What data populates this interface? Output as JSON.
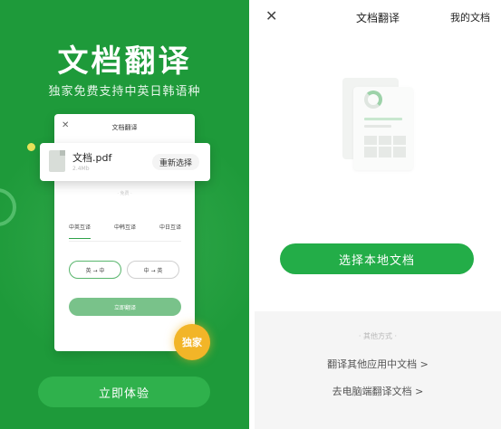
{
  "promo": {
    "title": "文档翻译",
    "subtitle": "独家免费支持中英日韩语种",
    "mock": {
      "close_glyph": "✕",
      "title": "文档翻译",
      "hint": "· 免费 ·",
      "file_name": "文档.pdf",
      "file_size": "2.4Mb",
      "reselect_label": "重新选择",
      "tabs": [
        "中英互译",
        "中韩互译",
        "中日互译"
      ],
      "pill_1": "英 → 中",
      "pill_2": "中 → 英",
      "translate_label": "立即翻译"
    },
    "badge_label": "独家",
    "try_label": "立即体验"
  },
  "app": {
    "close_glyph": "✕",
    "title": "文档翻译",
    "my_docs_label": "我的文档",
    "choose_label": "选择本地文档",
    "other_label": "· 其他方式 ·",
    "links": [
      "翻译其他应用中文档 >",
      "去电脑端翻译文档 >"
    ]
  },
  "colors": {
    "promo_bg": "#1e9a3a",
    "accent_green": "#23ad48",
    "badge_yellow": "#f2b528"
  }
}
